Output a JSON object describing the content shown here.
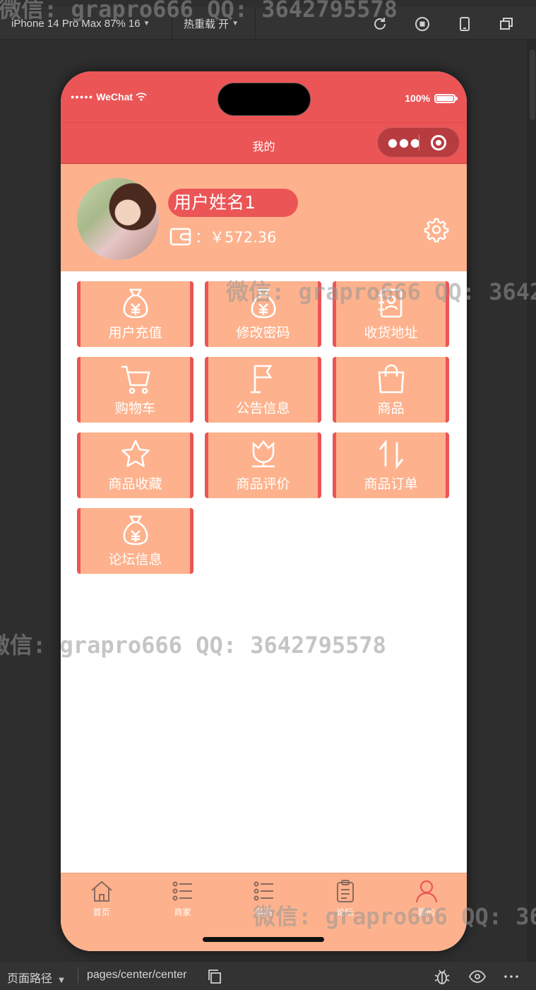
{
  "toolbar": {
    "device_label": "iPhone 14 Pro Max 87% 16",
    "hot_reload_label": "热重载 开"
  },
  "status_bar": {
    "carrier": "WeChat",
    "battery": "100%"
  },
  "navbar": {
    "title": "我的"
  },
  "profile": {
    "username": "用户姓名1",
    "balance": "：￥572.36"
  },
  "menu": [
    {
      "label": "用户充值",
      "icon": "money-bag-icon"
    },
    {
      "label": "修改密码",
      "icon": "money-bag-icon"
    },
    {
      "label": "收货地址",
      "icon": "address-book-icon"
    },
    {
      "label": "购物车",
      "icon": "cart-icon"
    },
    {
      "label": "公告信息",
      "icon": "flag-icon"
    },
    {
      "label": "商品",
      "icon": "shopping-bag-icon"
    },
    {
      "label": "商品收藏",
      "icon": "star-icon"
    },
    {
      "label": "商品评价",
      "icon": "tulip-icon"
    },
    {
      "label": "商品订单",
      "icon": "sort-arrows-icon"
    },
    {
      "label": "论坛信息",
      "icon": "money-bag-icon"
    }
  ],
  "tabbar": [
    {
      "label": "首页",
      "icon": "home-icon"
    },
    {
      "label": "商家",
      "icon": "list-icon"
    },
    {
      "label": "商品",
      "icon": "list-icon"
    },
    {
      "label": "论坛",
      "icon": "clipboard-icon"
    },
    {
      "label": "我的",
      "icon": "user-icon",
      "active": true
    }
  ],
  "bottom_bar": {
    "path_label": "页面路径",
    "path": "pages/center/center"
  },
  "watermark": "微信: grapro666 QQ: 3642795578",
  "colors": {
    "primary": "#eb5556",
    "secondary": "#fdb28d",
    "ide_background": "#2e2e2e"
  }
}
